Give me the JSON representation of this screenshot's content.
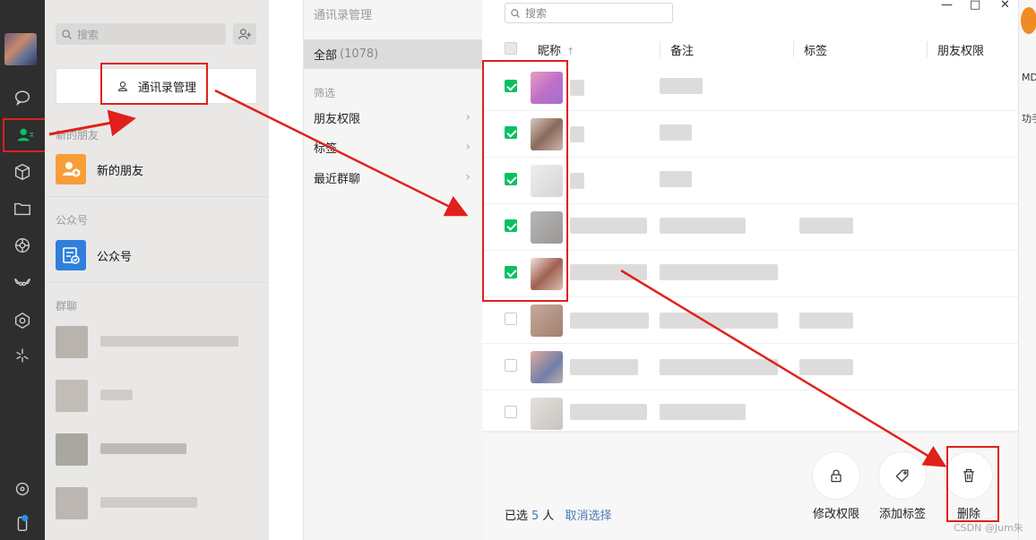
{
  "contacts_panel": {
    "search_placeholder": "搜索",
    "manager_button": "通讯录管理",
    "section_new_friends": "新的朋友",
    "new_friends_label": "新的朋友",
    "section_official": "公众号",
    "official_label": "公众号",
    "section_groups": "群聊"
  },
  "filter_panel": {
    "title": "通讯录管理",
    "all_label": "全部",
    "all_count": "(1078)",
    "filter_heading": "筛选",
    "items": [
      "朋友权限",
      "标签",
      "最近群聊"
    ],
    "chevron": "›"
  },
  "table": {
    "search_placeholder": "搜索",
    "columns": [
      "昵称",
      "备注",
      "标签",
      "朋友权限"
    ],
    "sort_indicator": "↑",
    "rows_checked": [
      true,
      true,
      true,
      true,
      true,
      false,
      false,
      false
    ]
  },
  "footer": {
    "selected_prefix": "已选",
    "selected_count": "5",
    "selected_unit": "人",
    "cancel_selection": "取消选择",
    "actions": [
      "修改权限",
      "添加标签",
      "删除"
    ]
  },
  "window_controls": {
    "minimize": "—",
    "maximize": "□",
    "close": "✕"
  },
  "right_strip": {
    "line1": "MD",
    "line2": "功手"
  },
  "watermark": "CSDN @Jum朱",
  "colors": {
    "accent_green": "#07c160",
    "highlight_red": "#e0201b",
    "link_blue": "#4a78b0",
    "sidebar_dark": "#2e2e2e"
  }
}
